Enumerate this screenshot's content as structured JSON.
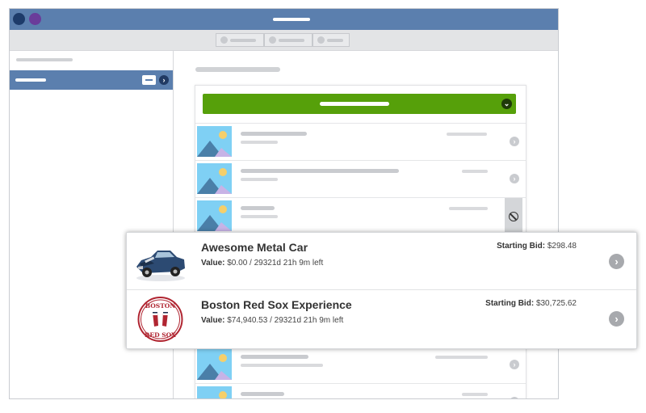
{
  "window": {
    "title_bar_colors": {
      "bar": "#5b7fae",
      "close": "#1d3b6a",
      "minimize": "#6a3c9a"
    }
  },
  "icons": {
    "chevron": "›",
    "chevron_down": "⌄"
  },
  "accent": {
    "primary": "#5b7fae",
    "action_green": "#56a00a"
  },
  "popout": {
    "items": [
      {
        "title": "Awesome Metal Car",
        "value_label": "Value:",
        "value_text": "$0.00 / 29321d 21h 9m left",
        "bid_label": "Starting Bid:",
        "bid_amount": "$298.48",
        "image": "toy-car-photo"
      },
      {
        "title": "Boston Red Sox Experience",
        "value_label": "Value:",
        "value_text": "$74,940.53 / 29321d 21h 9m left",
        "bid_label": "Starting Bid:",
        "bid_amount": "$30,725.62",
        "image": "red-sox-logo",
        "logo_text_top": "BOSTON",
        "logo_text_bottom": "RED SOX"
      }
    ]
  }
}
